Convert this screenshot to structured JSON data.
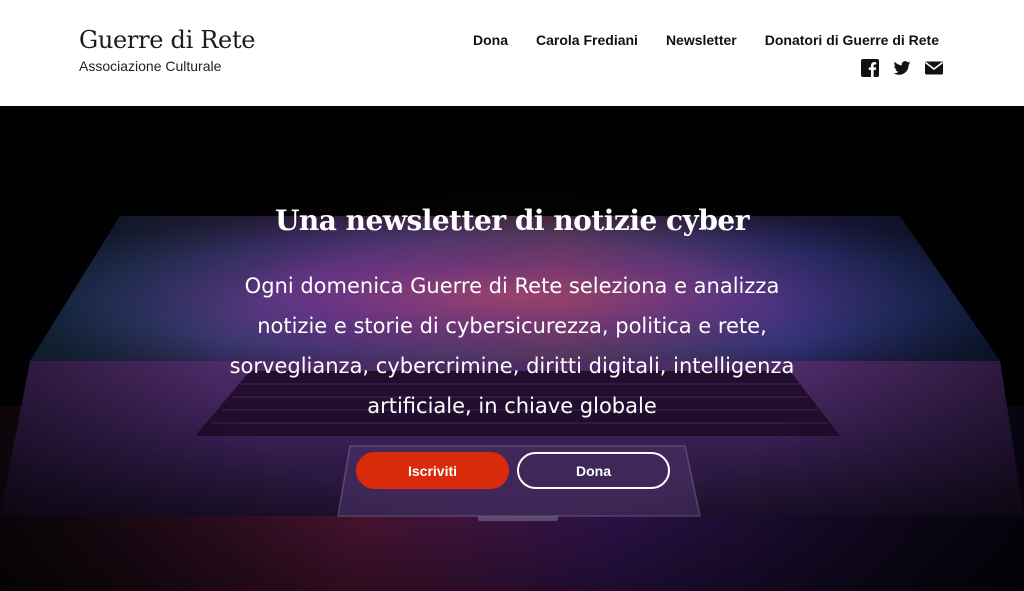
{
  "header": {
    "site_title": "Guerre di Rete",
    "site_description": "Associazione Culturale",
    "nav": [
      {
        "label": "Dona"
      },
      {
        "label": "Carola Frediani"
      },
      {
        "label": "Newsletter"
      },
      {
        "label": "Donatori di Guerre di Rete"
      }
    ],
    "social": [
      "facebook-icon",
      "twitter-icon",
      "email-icon"
    ]
  },
  "hero": {
    "title": "Una newsletter di notizie cyber",
    "description": "Ogni domenica Guerre di Rete seleziona e analizza notizie e storie di cybersicurezza, politica e rete, sorveglianza, cybercrimine, diritti digitali, intelligenza artificiale, in chiave globale",
    "primary_button": "Iscriviti",
    "secondary_button": "Dona"
  },
  "colors": {
    "accent": "#d92a0c",
    "header_bg": "#ffffff",
    "hero_bg": "#030306"
  }
}
